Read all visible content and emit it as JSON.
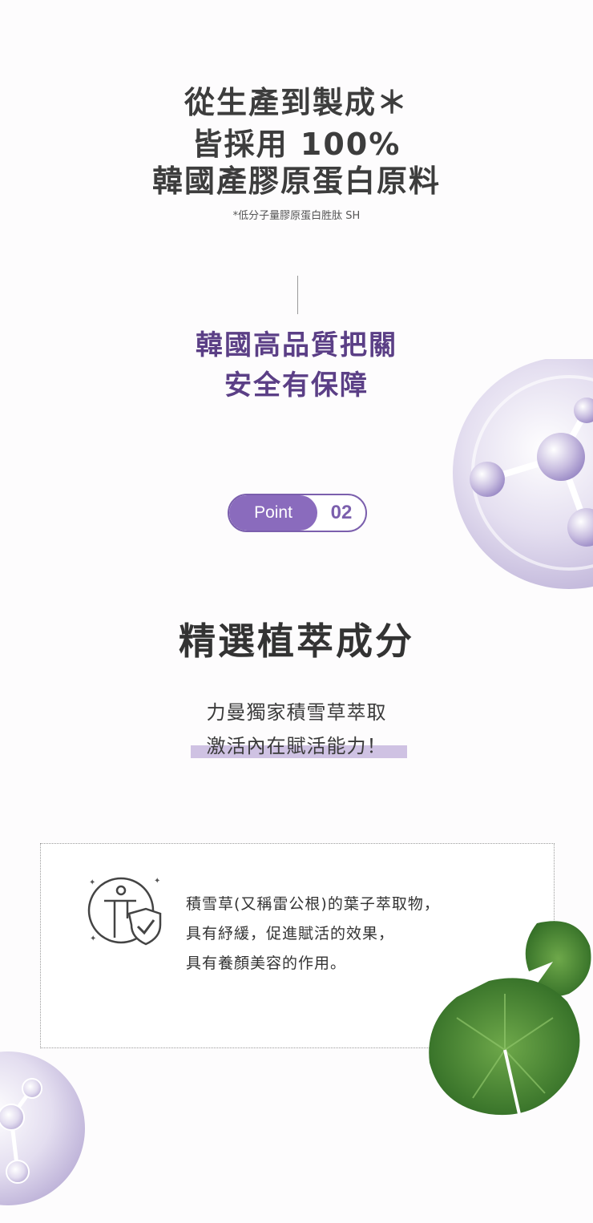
{
  "hero": {
    "line1": "從生產到製成＊",
    "line2": "皆採用 100%",
    "line3": "韓國產膠原蛋白原料",
    "footnote": "*低分子量膠原蛋白胜肽 SH"
  },
  "quality": {
    "line1": "韓國高品質把關",
    "line2": "安全有保障"
  },
  "point": {
    "label": "Point",
    "number": "02"
  },
  "section": {
    "title": "精選植萃成分",
    "sub1": "力曼獨家積雪草萃取",
    "sub2": "激活內在賦活能力！"
  },
  "info": {
    "icon": "body-shield-check-icon",
    "line1": "積雪草(又稱雷公根)的葉子萃取物，",
    "line2": "具有紓緩，促進賦活的效果，",
    "line3": "具有養顏美容的作用。"
  },
  "colors": {
    "accent": "#5b3f86",
    "badge": "#8a6bbd",
    "highlight": "#cfc2e3"
  }
}
